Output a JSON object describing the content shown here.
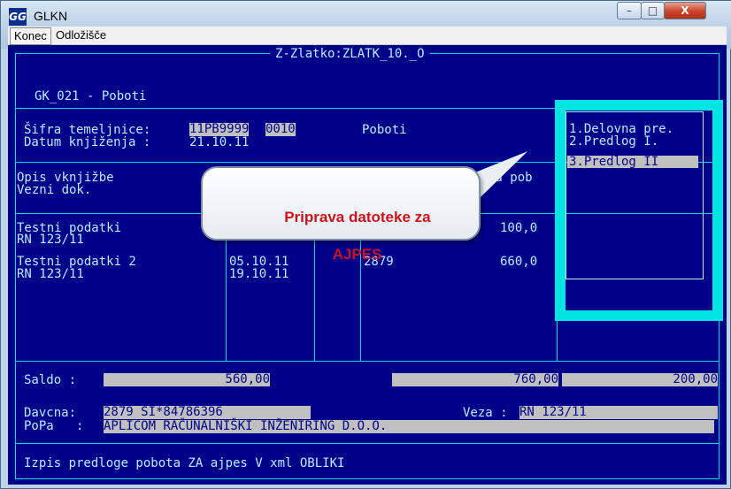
{
  "window": {
    "icon_text": "GG",
    "title": "GLKN",
    "controls": {
      "minimize": "–",
      "maximize": "□",
      "close": "X"
    }
  },
  "menubar": {
    "items": [
      "Konec",
      "Odložišče"
    ]
  },
  "console": {
    "frame_title": "Z-Zlatko:ZLATK_10._O",
    "screen_title": "GK_021 - Poboti",
    "sifra_label": "Šifra temeljnice: ",
    "sifra_value_1": "11PB9999",
    "sifra_value_2": "0010",
    "doc_type": "Poboti",
    "datum_label": "Datum knjiženja : ",
    "datum_value": "21.10.11",
    "col_opis": "Opis vknjižbe",
    "col_vezni": "Vezni dok.",
    "col_za_pob": "Za pob",
    "rows": [
      {
        "desc": "Testni podatki",
        "ref": "RN 123/11",
        "date": "",
        "num": "",
        "amount": "100,0"
      },
      {
        "desc": "Testni podatki 2",
        "ref": "RN 123/11",
        "date": "05.10.11",
        "date2": "19.10.11",
        "num": "2879",
        "amount": "660,0"
      }
    ],
    "saldo_label": "Saldo :",
    "saldo_1": "560,00",
    "saldo_2": "760,00",
    "saldo_3": "200,00",
    "davcna_label": "Davcna:",
    "davcna_value": "2879 SI*84786396",
    "veza_label": "Veza :",
    "veza_value": "RN 123/11",
    "popa_label": "PoPa   :",
    "popa_value": "APLICOM RAČUNALNIŠKI INŽENIRING D.O.O.",
    "status": "Izpis predloge pobota ZA ajpes V xml OBLIKI"
  },
  "popup_menu": {
    "items": [
      "1.Delovna pre.",
      "2.Predlog I.",
      "3.Predlog II"
    ],
    "selected_index": 2
  },
  "callout": {
    "line1": "Priprava datoteke za",
    "line2": "AJPES"
  },
  "colors": {
    "console_bg": "#000088",
    "text": "#b8ecff",
    "frame": "#00dcdc",
    "highlight": "#c0c0c0",
    "callout_text": "#c8141c"
  }
}
